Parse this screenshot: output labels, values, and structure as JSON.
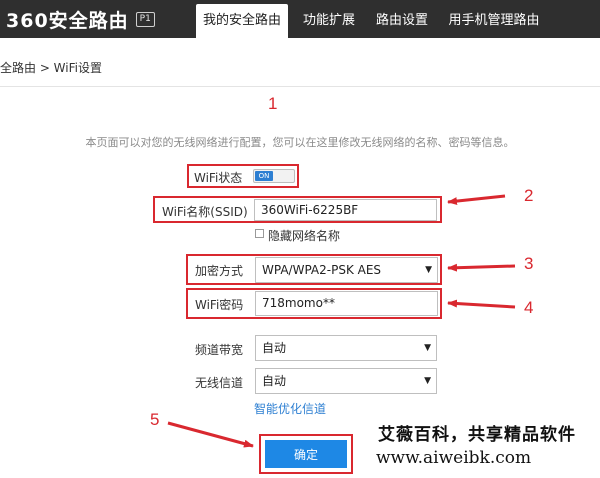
{
  "app": {
    "logo_text": "360安全路由",
    "logo_badge": "P1"
  },
  "nav": {
    "tabs": [
      {
        "label": "我的安全路由",
        "active": true
      },
      {
        "label": "功能扩展",
        "active": false
      },
      {
        "label": "路由设置",
        "active": false
      },
      {
        "label": "用手机管理路由",
        "active": false
      }
    ]
  },
  "breadcrumb": "全路由 > WiFi设置",
  "description": "本页面可以对您的无线网络进行配置，您可以在这里修改无线网络的名称、密码等信息。",
  "form": {
    "wifi_status_label": "WiFi状态",
    "wifi_status_toggle": "ON",
    "ssid_label": "WiFi名称(SSID)",
    "ssid_value": "360WiFi-6225BF",
    "hide_ssid_label": "隐藏网络名称",
    "encryption_label": "加密方式",
    "encryption_value": "WPA/WPA2-PSK AES",
    "password_label": "WiFi密码",
    "password_value": "718momo**",
    "bandwidth_label": "频道带宽",
    "bandwidth_value": "自动",
    "channel_label": "无线信道",
    "channel_value": "自动",
    "optimize_link": "智能优化信道",
    "confirm_button": "确定"
  },
  "annotations": {
    "n1": "1",
    "n2": "2",
    "n3": "3",
    "n4": "4",
    "n5": "5"
  },
  "watermark": {
    "line1": "艾薇百科，共享精品软件",
    "line2": "www.aiweibk.com"
  },
  "colors": {
    "topbar": "#2f2f2f",
    "accent": "#1e88e5",
    "annotation_red": "#d9282f",
    "link": "#2d7fd2"
  }
}
